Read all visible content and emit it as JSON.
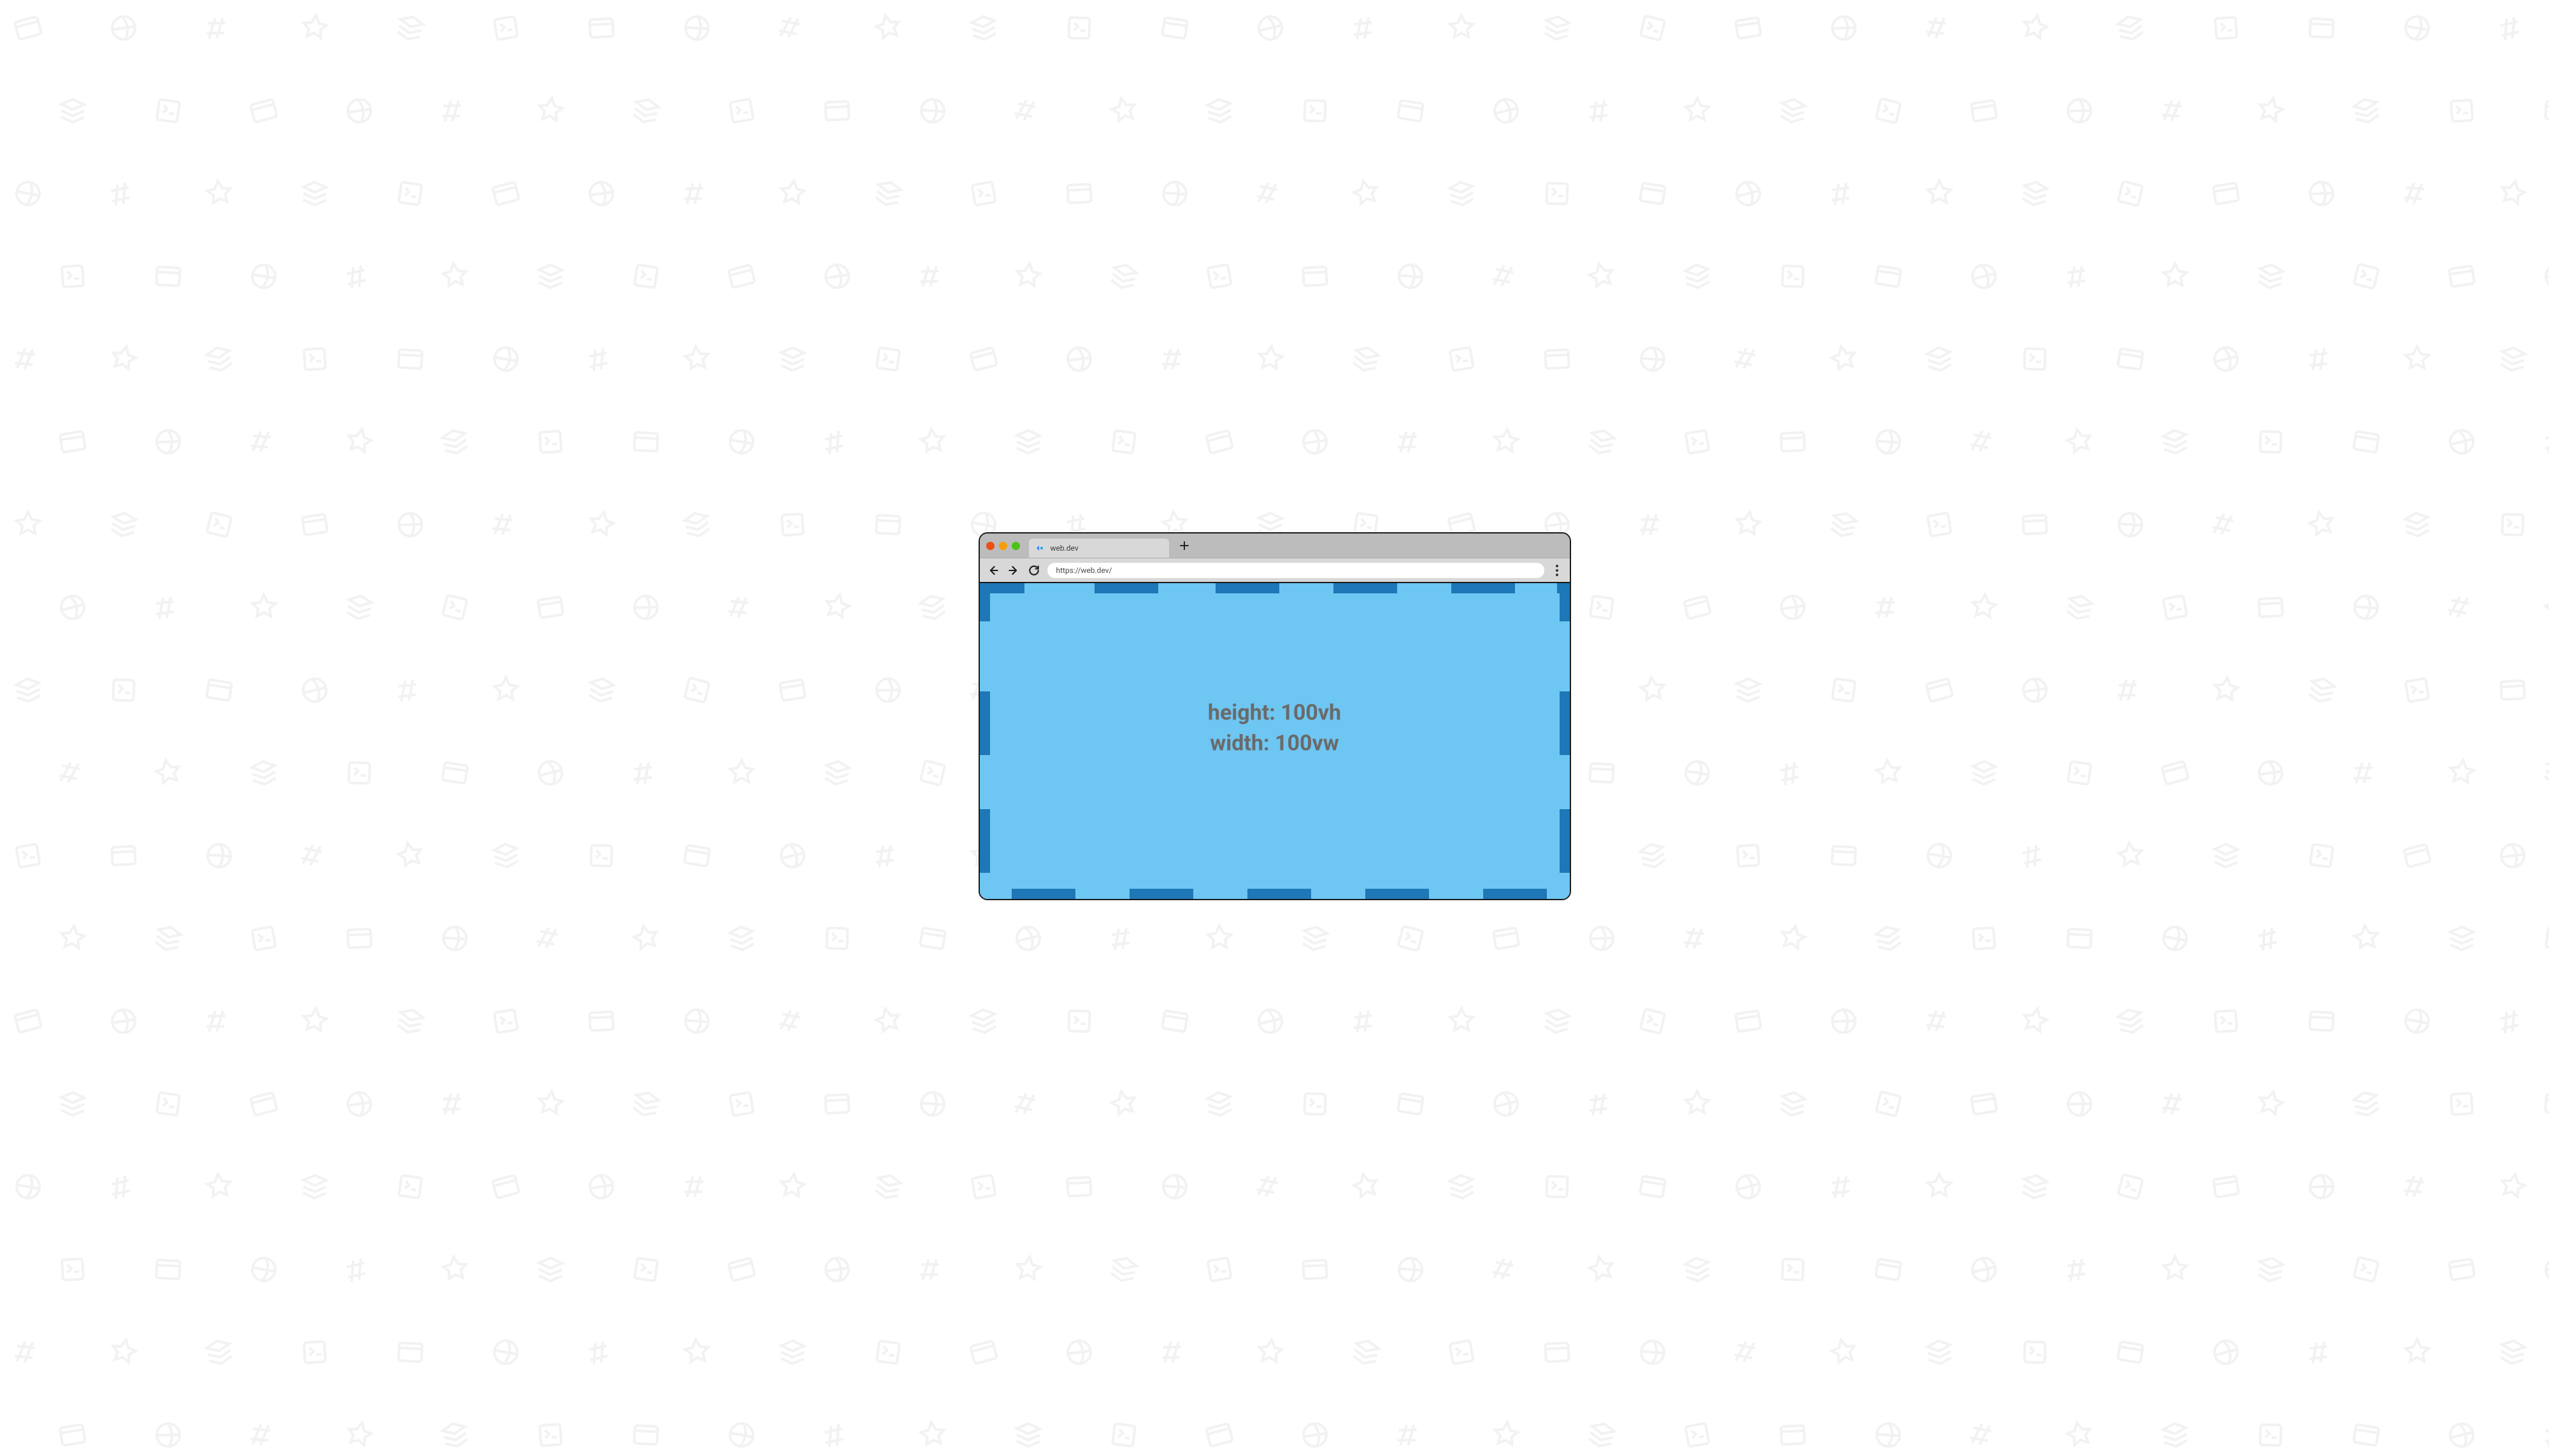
{
  "tab": {
    "title": "web.dev"
  },
  "address": {
    "url": "https://web.dev/"
  },
  "viewport": {
    "line1": "height: 100vh",
    "line2": "width: 100vw"
  },
  "colors": {
    "viewport_bg": "#6ec6f2",
    "dash": "#1e77b6",
    "chrome_bg": "#bcbcbc",
    "toolbar_bg": "#d8d8d8"
  }
}
